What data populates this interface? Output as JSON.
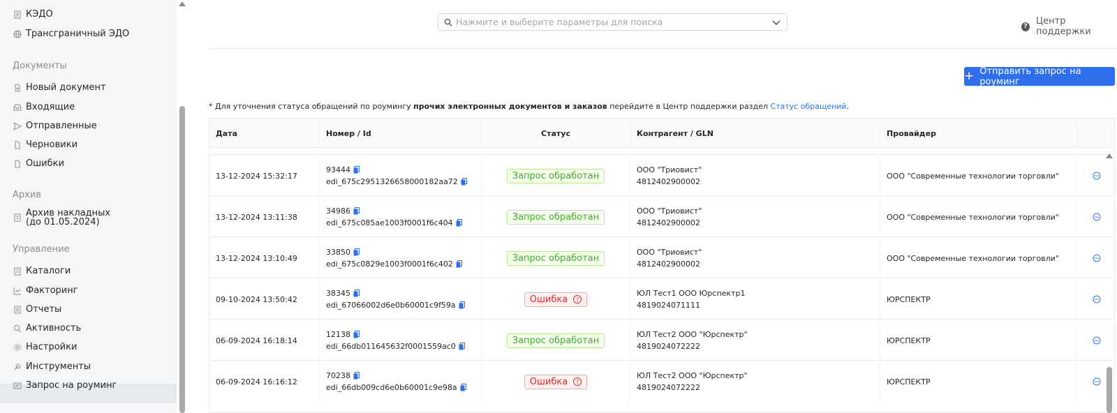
{
  "sidebar": {
    "top_items": [
      {
        "label": "КЭДО",
        "icon": "document-list-icon"
      },
      {
        "label": "Трансграничный ЭДО",
        "icon": "globe-icon"
      }
    ],
    "sections": [
      {
        "title": "Документы",
        "items": [
          {
            "label": "Новый документ",
            "icon": "new-document-icon"
          },
          {
            "label": "Входящие",
            "icon": "inbox-icon"
          },
          {
            "label": "Отправленные",
            "icon": "send-icon"
          },
          {
            "label": "Черновики",
            "icon": "draft-icon"
          },
          {
            "label": "Ошибки",
            "icon": "error-document-icon"
          }
        ]
      },
      {
        "title": "Архив",
        "items": [
          {
            "label_line1": "Архив накладных",
            "label_line2": "(до 01.05.2024)",
            "icon": "archive-icon"
          }
        ]
      },
      {
        "title": "Управление",
        "items": [
          {
            "label": "Каталоги",
            "icon": "catalog-icon"
          },
          {
            "label": "Факторинг",
            "icon": "chart-icon"
          },
          {
            "label": "Отчеты",
            "icon": "report-icon"
          },
          {
            "label": "Активность",
            "icon": "search-icon"
          },
          {
            "label": "Настройки",
            "icon": "gear-icon"
          },
          {
            "label": "Инструменты",
            "icon": "wrench-icon"
          },
          {
            "label": "Запрос на роуминг",
            "icon": "roaming-icon",
            "active": true
          }
        ]
      }
    ]
  },
  "search": {
    "placeholder": "Нажмите и выберите параметры для поиска"
  },
  "help": {
    "label": "Центр поддержки"
  },
  "primary_button": {
    "label": "Отправить запрос на роуминг"
  },
  "note": {
    "prefix": "* Для уточнения статуса обращений по роумингу ",
    "bold": "прочих электронных документов и заказов",
    "middle": " перейдите в Центр поддержки раздел ",
    "link": "Статус обращений",
    "suffix": "."
  },
  "table": {
    "headers": {
      "date": "Дата",
      "number": "Номер / Id",
      "status": "Статус",
      "counterparty": "Контрагент / GLN",
      "provider": "Провайдер"
    },
    "rows": [
      {
        "date": "13-12-2024 15:32:17",
        "number": "93444",
        "id": "edi_675c2951326658000182aa72",
        "status": "Запрос обработан",
        "status_type": "ok",
        "counterparty": "ООО \"Триовист\"",
        "gln": "4812402900002",
        "provider": "ООО \"Современные технологии торговли\""
      },
      {
        "date": "13-12-2024 13:11:38",
        "number": "34986",
        "id": "edi_675c085ae1003f0001f6c404",
        "status": "Запрос обработан",
        "status_type": "ok",
        "counterparty": "ООО \"Триовист\"",
        "gln": "4812402900002",
        "provider": "ООО \"Современные технологии торговли\""
      },
      {
        "date": "13-12-2024 13:10:49",
        "number": "33850",
        "id": "edi_675c0829e1003f0001f6c402",
        "status": "Запрос обработан",
        "status_type": "ok",
        "counterparty": "ООО \"Триовист\"",
        "gln": "4812402900002",
        "provider": "ООО \"Современные технологии торговли\""
      },
      {
        "date": "09-10-2024 13:50:42",
        "number": "38345",
        "id": "edi_67066002d6e0b60001c9f59a",
        "status": "Ошибка",
        "status_type": "err",
        "counterparty": "ЮЛ Тест1 ООО Юрспектр1",
        "gln": "4819024071111",
        "provider": "ЮРСПЕКТР"
      },
      {
        "date": "06-09-2024 16:18:14",
        "number": "12138",
        "id": "edi_66db011645632f0001559ac0",
        "status": "Запрос обработан",
        "status_type": "ok",
        "counterparty": "ЮЛ Тест2 ООО \"Юрспектр\"",
        "gln": "4819024072222",
        "provider": "ЮРСПЕКТР"
      },
      {
        "date": "06-09-2024 16:16:12",
        "number": "70238",
        "id": "edi_66db009cd6e0b60001c9e98a",
        "status": "Ошибка",
        "status_type": "err",
        "counterparty": "ЮЛ Тест2 ООО \"Юрспектр\"",
        "gln": "4819024072222",
        "provider": "ЮРСПЕКТР"
      }
    ]
  },
  "colors": {
    "accent": "#2f6fed",
    "ok": "#3fae29",
    "error": "#e0282e",
    "sidebar_bg": "#f5f6f8"
  }
}
